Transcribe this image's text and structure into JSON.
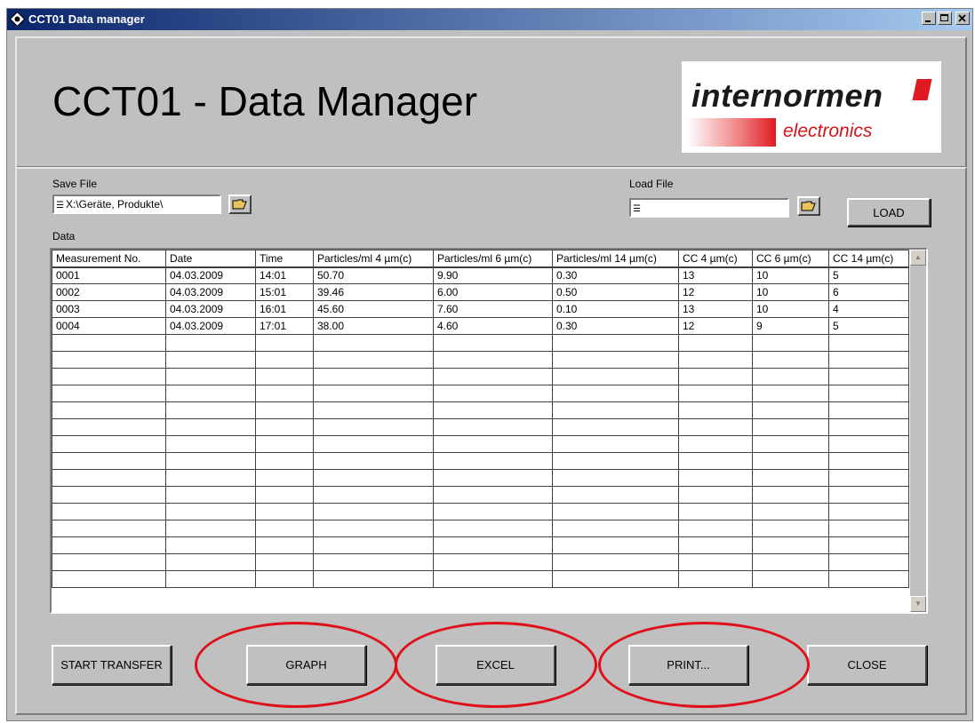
{
  "window": {
    "title": "CCT01 Data manager"
  },
  "header": {
    "title": "CCT01 - Data Manager"
  },
  "logo": {
    "brand": "internormen",
    "sub": "electronics"
  },
  "save": {
    "label": "Save File",
    "path": "X:\\Geräte, Produkte\\"
  },
  "load": {
    "label": "Load File",
    "path": "",
    "button": "LOAD"
  },
  "data_label": "Data",
  "table": {
    "columns": [
      "Measurement No.",
      "Date",
      "Time",
      "Particles/ml 4 µm(c)",
      "Particles/ml 6 µm(c)",
      "Particles/ml 14 µm(c)",
      "CC 4 µm(c)",
      "CC 6 µm(c)",
      "CC 14 µm(c)"
    ],
    "rows": [
      [
        "0001",
        "04.03.2009",
        "14:01",
        "50.70",
        "9.90",
        "0.30",
        "13",
        "10",
        "5"
      ],
      [
        "0002",
        "04.03.2009",
        "15:01",
        "39.46",
        "6.00",
        "0.50",
        "12",
        "10",
        "6"
      ],
      [
        "0003",
        "04.03.2009",
        "16:01",
        "45.60",
        "7.60",
        "0.10",
        "13",
        "10",
        "4"
      ],
      [
        "0004",
        "04.03.2009",
        "17:01",
        "38.00",
        "4.60",
        "0.30",
        "12",
        "9",
        "5"
      ]
    ]
  },
  "buttons": {
    "start_transfer": "START TRANSFER",
    "graph": "GRAPH",
    "excel": "EXCEL",
    "print": "PRINT...",
    "close": "CLOSE"
  },
  "colors": {
    "title_bar": "#0a246a",
    "highlight": "#e0101a",
    "panel": "#c0c0c0"
  }
}
